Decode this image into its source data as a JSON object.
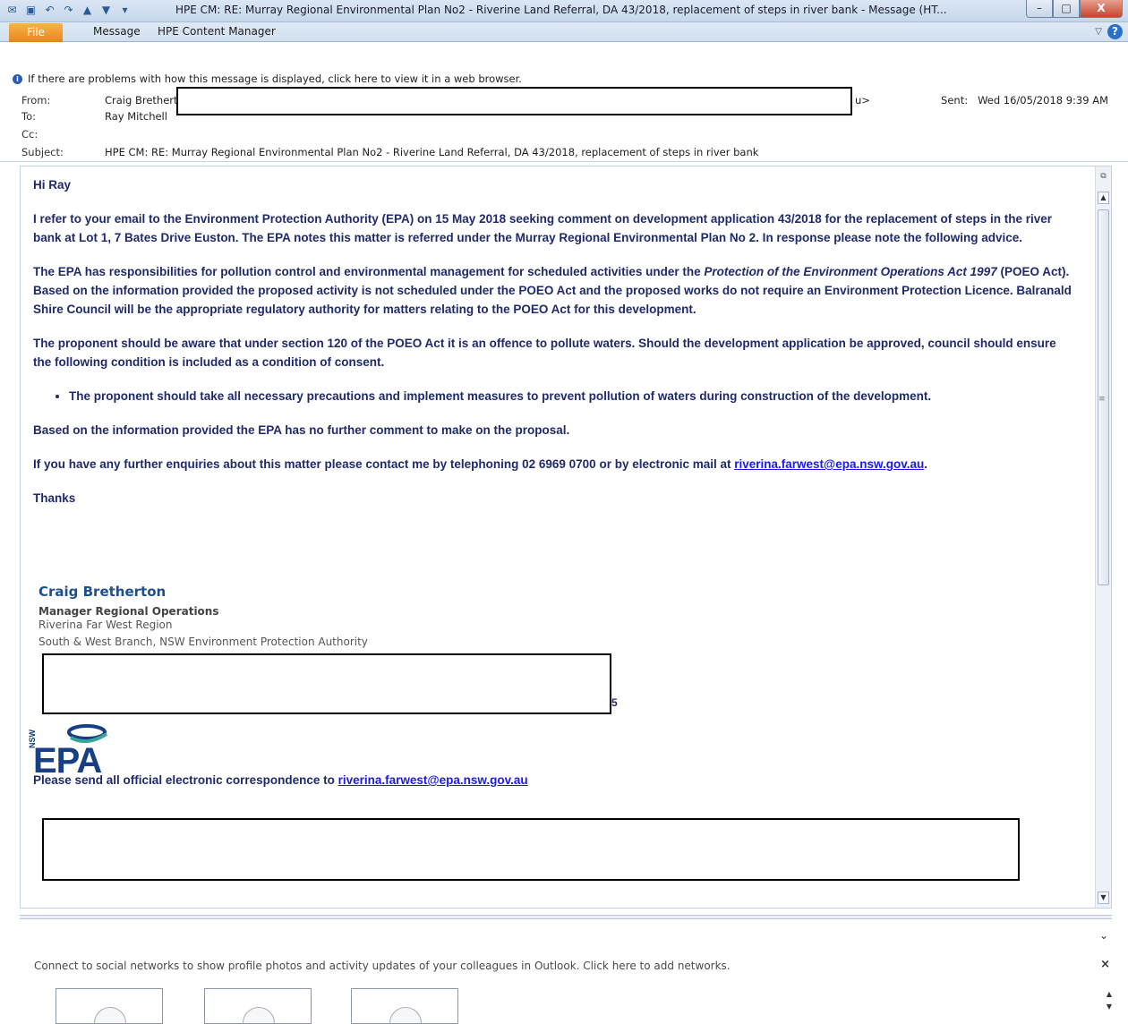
{
  "window": {
    "title": "HPE CM: RE: Murray Regional Environmental Plan No2 - Riverine Land Referral, DA 43/2018, replacement of steps in river bank  -  Message (HT...",
    "buttons": {
      "minimize": "–",
      "maximize": "□",
      "close": "X"
    },
    "qat_icons": [
      "mail-icon",
      "save-icon",
      "undo-icon",
      "redo-icon",
      "up-arrow-icon",
      "down-arrow-icon",
      "customize-icon"
    ]
  },
  "ribbon": {
    "file_label": "File",
    "tabs": [
      "Message",
      "HPE Content Manager"
    ],
    "help_label": "?"
  },
  "header": {
    "infobar": "If there are problems with how this message is displayed, click here to view it in a web browser.",
    "from_label": "From:",
    "from_value": "Craig Brethert",
    "from_suffix": "u>",
    "to_label": "To:",
    "to_value": "Ray Mitchell",
    "cc_label": "Cc:",
    "subject_label": "Subject:",
    "subject_value": "HPE CM: RE: Murray Regional Environmental Plan No2 - Riverine Land Referral, DA 43/2018, replacement of steps in river bank",
    "sent_label": "Sent:",
    "sent_value": "Wed 16/05/2018 9:39 AM"
  },
  "message": {
    "greeting": "Hi Ray",
    "p1": "I refer to your email to the Environment Protection Authority (EPA) on 15 May 2018 seeking comment on development application 43/2018 for the replacement of steps in the river bank at Lot 1, 7 Bates Drive Euston. The EPA notes this matter is referred under the Murray Regional Environmental Plan No 2. In response please note the following advice.",
    "p2_a": "The EPA has responsibilities for pollution control and environmental management for scheduled activities under the ",
    "p2_italic": "Protection of the Environment Operations Act 1997",
    "p2_b": " (POEO Act). Based on the information provided the proposed activity is not scheduled under the POEO Act and the proposed works do not require an Environment Protection Licence. Balranald Shire Council will be the appropriate regulatory authority for matters relating to the POEO Act for this development.",
    "p3": "The proponent should be aware that under section 120 of the POEO Act it is an offence to pollute waters. Should the development application be approved, council should ensure the following condition is included as a condition of consent.",
    "bullet": "The proponent should take all necessary precautions and implement measures to prevent pollution of waters during construction of the development.",
    "p4": "Based on the information provided the EPA has no further comment to make on the proposal.",
    "p5_a": "If you have any further enquiries about this matter please contact me by telephoning 02 6969 0700 or by electronic mail at ",
    "p5_link": "riverina.farwest@epa.nsw.gov.au",
    "p5_b": ".",
    "thanks": "Thanks"
  },
  "signature": {
    "name": "Craig Bretherton",
    "title": "Manager Regional Operations",
    "region": "Riverina Far West Region",
    "branch": "South & West Branch, NSW Environment Protection Authority",
    "trailing_digit": "5",
    "logo_text": "EPA",
    "logo_small": "NSW",
    "official_text": "Please send all official electronic correspondence to ",
    "official_link": "riverina.farwest@epa.nsw.gov.au"
  },
  "people_pane": {
    "text": "Connect to social networks to show profile photos and activity updates of your colleagues in Outlook. Click here to add networks.",
    "close": "×",
    "collapse": "⌄"
  },
  "colors": {
    "body_text": "#1f2a6b",
    "link": "#1a1aee",
    "file_tab": "#e6871a",
    "epa_blue": "#163f85",
    "epa_green": "#3aa59a"
  }
}
